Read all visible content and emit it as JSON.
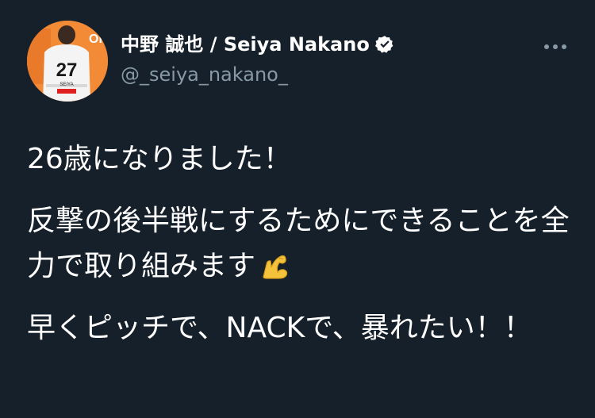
{
  "tweet": {
    "author": {
      "display_name": "中野 誠也 / Seiya Nakano",
      "handle": "@_seiya_nakano_",
      "verified": true,
      "avatar": {
        "jersey_number": "27",
        "jersey_name": "SEIYA",
        "sponsor_text": "Ol",
        "background_color": "#f28a36"
      }
    },
    "more_icon": "more-horizontal-icon",
    "paragraphs": [
      "26歳になりました！",
      "反撃の後半戦にするためにできることを全力で取り組みます",
      "早くピッチで、NACKで、暴れたい！！"
    ],
    "emoji": "flexed-biceps"
  },
  "colors": {
    "background": "#15202b",
    "text_primary": "#ffffff",
    "text_secondary": "#8899a6",
    "verified_badge": "#ffffff"
  }
}
